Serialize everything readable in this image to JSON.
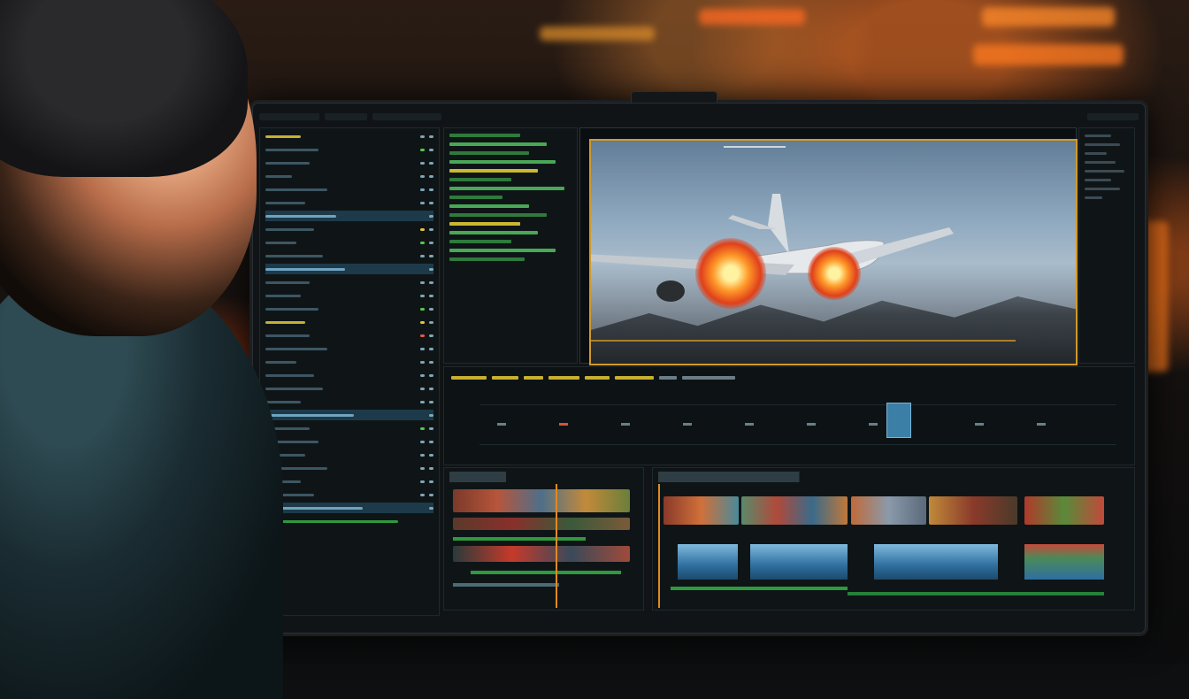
{
  "scene": {
    "description_free": true,
    "subject": "video-editing-workstation"
  },
  "ui": {
    "app_colors": {
      "accent": "#d39a2a",
      "timeline_green": "#2e9a3d",
      "panel_bg": "#0f1517"
    }
  }
}
